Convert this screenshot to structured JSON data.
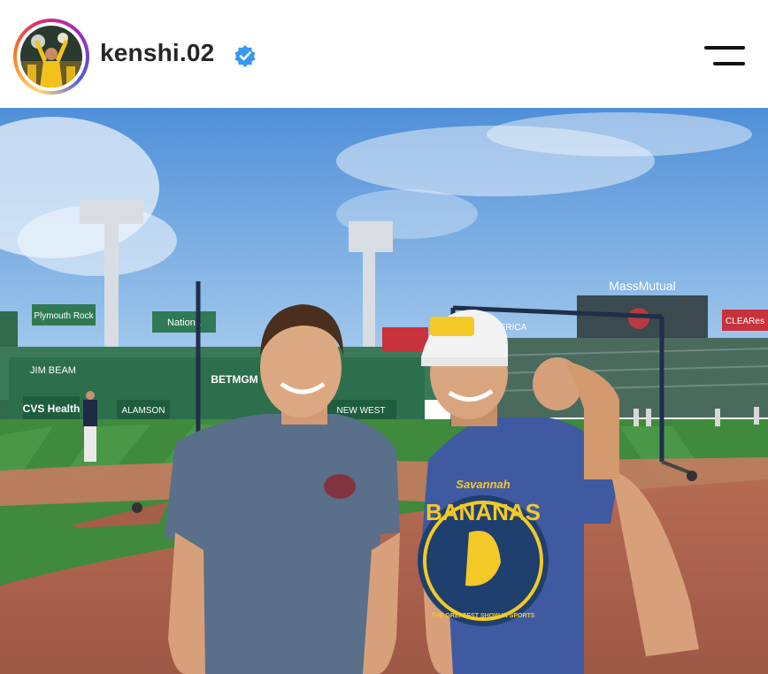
{
  "post": {
    "username": "kenshi.02",
    "verified": true,
    "accent_color": "#3897f0"
  },
  "header": {
    "avatar_icon": "profile-avatar",
    "verified_icon": "verified-badge-icon",
    "menu_icon": "menu-icon"
  },
  "photo": {
    "signs": {
      "plymouth": "Plymouth Rock",
      "national": "Nationa",
      "jimbeam": "JIM BEAM",
      "cvs": "CVS Health",
      "betmgm": "BETMGM",
      "massmutual": "MassMutual",
      "clear": "CLEARes",
      "erica": "ERICA",
      "alamson": "ALAMSON",
      "newwest": "NEW WEST"
    },
    "shirt_text": {
      "savannah": "Savannah",
      "bananas": "BANANAS",
      "tagline": "THE GREATEST SHOW IN SPORTS"
    }
  }
}
